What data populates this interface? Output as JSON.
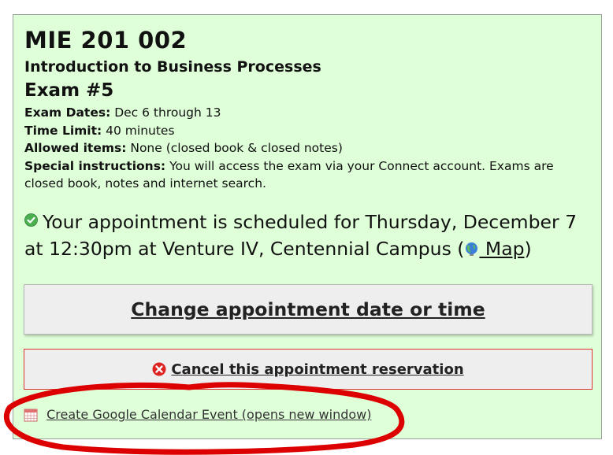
{
  "exam": {
    "course_code": "MIE 201 002",
    "course_name": "Introduction to Business Processes",
    "exam_title": "Exam #5"
  },
  "details": {
    "dates_label": "Exam Dates:",
    "dates_value": "Dec 6 through 13",
    "time_label": "Time Limit:",
    "time_value": "40 minutes",
    "allowed_label": "Allowed items:",
    "allowed_value": "None (closed book & closed notes)",
    "special_label": "Special instructions:",
    "special_value": "You will access the exam via your Connect account. Exams are closed book, notes and internet search."
  },
  "appointment": {
    "text": "Your appointment is scheduled for Thursday, December 7 at 12:30pm at Venture IV, Centennial Campus (",
    "map_label": " Map",
    "close_paren": ")"
  },
  "actions": {
    "change_label": "Change appointment date or time",
    "cancel_label": "Cancel this appointment reservation",
    "gcal_label": "Create Google Calendar Event (opens new window)"
  },
  "icons": {
    "status": "check-circle-icon",
    "map": "globe-icon",
    "cancel": "x-circle-icon",
    "calendar": "calendar-icon"
  },
  "colors": {
    "panel_bg": "#dfffd9",
    "success_green": "#4caf50",
    "cancel_red": "#dd2222",
    "annotation_red": "#dd0000"
  }
}
